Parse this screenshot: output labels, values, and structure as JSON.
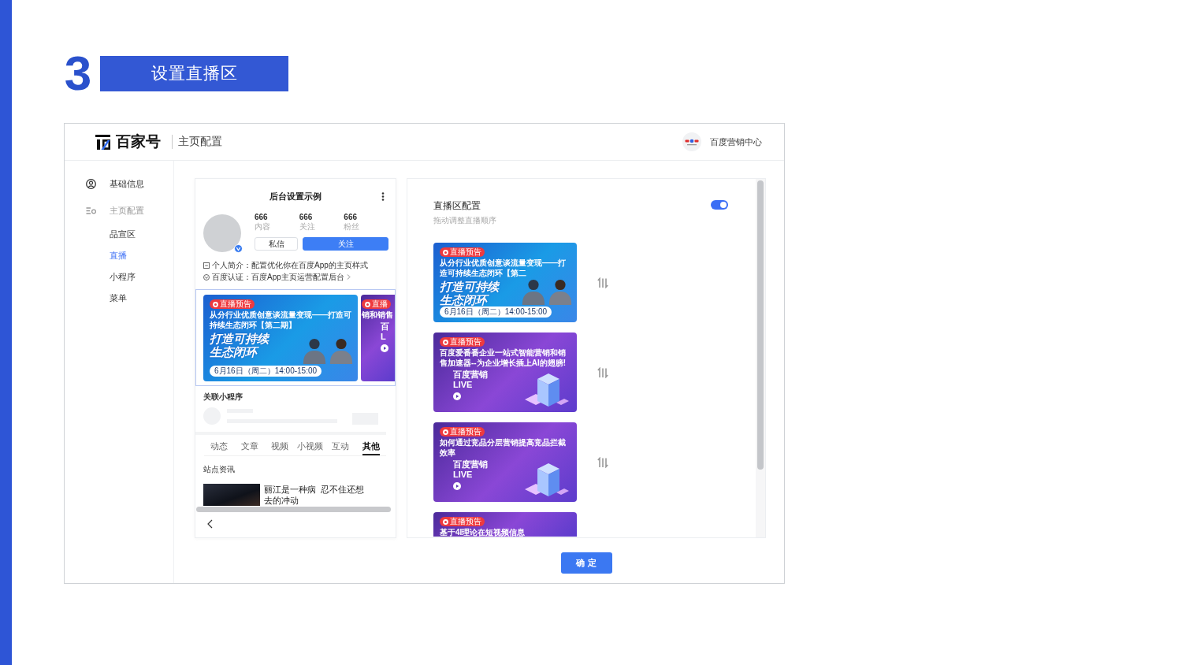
{
  "slide": {
    "step": "3",
    "title": "设置直播区"
  },
  "header": {
    "logo": "百家号",
    "page_title": "主页配置",
    "account": "百度营销中心"
  },
  "sidebar": {
    "items": [
      {
        "label": "基础信息",
        "selected": false
      },
      {
        "label": "主页配置",
        "selected": false,
        "children": [
          {
            "label": "品宣区",
            "selected": false
          },
          {
            "label": "直播",
            "selected": true
          },
          {
            "label": "小程序",
            "selected": false
          },
          {
            "label": "菜单",
            "selected": false
          }
        ]
      }
    ]
  },
  "preview": {
    "title": "后台设置示例",
    "stats": [
      {
        "value": "666",
        "label": "内容"
      },
      {
        "value": "666",
        "label": "关注"
      },
      {
        "value": "666",
        "label": "粉丝"
      }
    ],
    "buttons": [
      {
        "label": "私信",
        "kind": "secondary"
      },
      {
        "label": "关注",
        "kind": "primary"
      }
    ],
    "info": [
      {
        "kind": "intro",
        "text": "个人简介：配置优化你在百度App的主页样式"
      },
      {
        "kind": "verified",
        "text": "百度认证：百度App主页运营配置后台"
      }
    ],
    "live_cards": [
      {
        "kind": "speakers",
        "badge": "直播预告",
        "title": "从分行业优质创意谈流量变现——打造可持续生态闭环【第二期】",
        "headline": [
          "打造可持续",
          "生态闭环"
        ],
        "date": "6月16日（周二）14:00-15:00"
      },
      {
        "kind": "brand",
        "badge": "直播",
        "title": "销和销售",
        "headline": [
          "百",
          "L"
        ]
      }
    ],
    "mini_program_title": "关联小程序",
    "tabs": [
      {
        "label": "动态",
        "selected": false
      },
      {
        "label": "文章",
        "selected": false
      },
      {
        "label": "视频",
        "selected": false
      },
      {
        "label": "小视频",
        "selected": false
      },
      {
        "label": "互动",
        "selected": false
      },
      {
        "label": "其他",
        "selected": true
      }
    ],
    "section_title": "站点资讯",
    "article_title": "丽江是一种病  忍不住还想去的冲动"
  },
  "live_config": {
    "title": "直播区配置",
    "subtitle": "拖动调整直播顺序",
    "enabled": true,
    "cards": [
      {
        "kind": "speakers",
        "badge": "直播预告",
        "title": "从分行业优质创意谈流量变现——打造可持续生态闭环【第二",
        "headline": [
          "打造可持续",
          "生态闭环"
        ],
        "date": "6月16日（周二）14:00-15:00"
      },
      {
        "kind": "brand",
        "badge": "直播预告",
        "title": "百度爱番番企业一站式智能营销和销售加速器--为企业增长插上AI的翅膀!",
        "headline": [
          "百度营销",
          "LIVE"
        ]
      },
      {
        "kind": "brand",
        "badge": "直播预告",
        "title": "如何通过竞品分层营销提高竞品拦截效率",
        "headline": [
          "百度营销",
          "LIVE"
        ]
      },
      {
        "kind": "brand",
        "badge": "直播预告",
        "title": "基于4I理论在短视频信息"
      }
    ]
  },
  "confirm_button": "确 定"
}
